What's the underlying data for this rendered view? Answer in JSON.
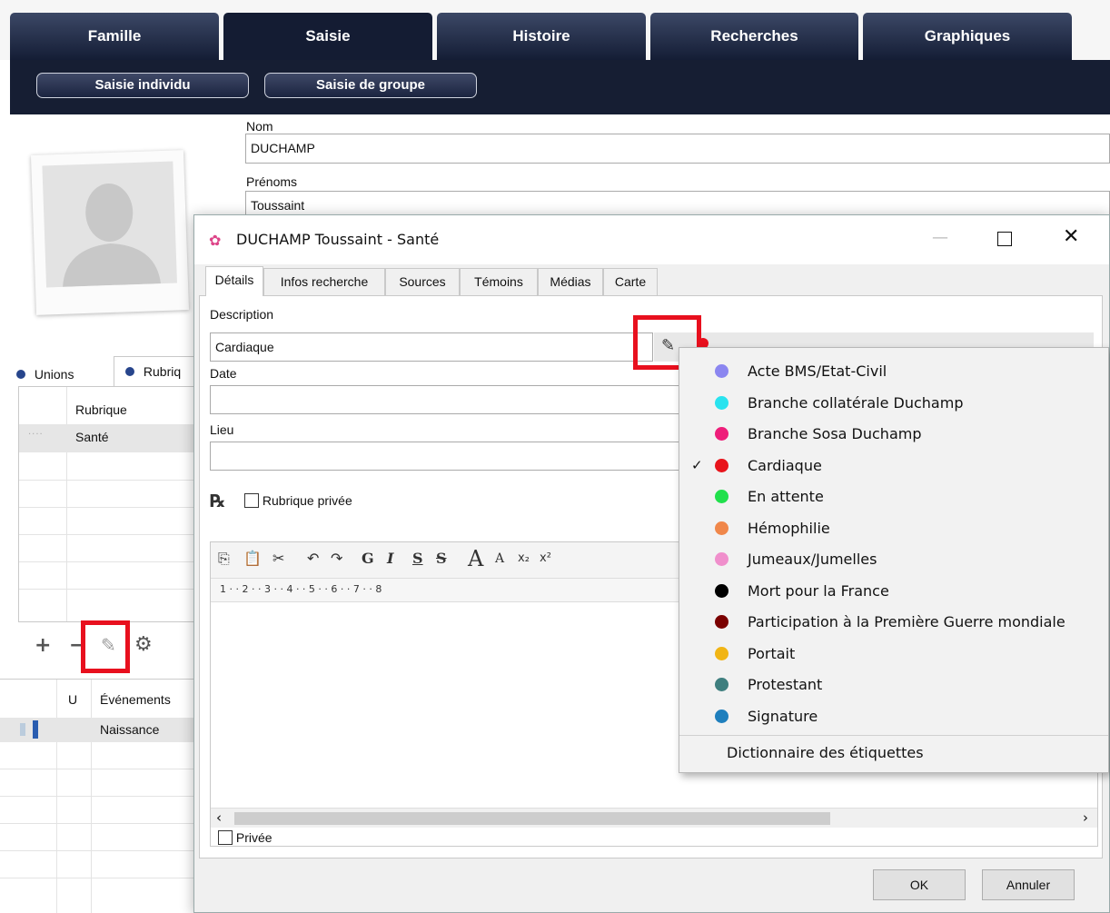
{
  "main_tabs": [
    "Famille",
    "Saisie",
    "Histoire",
    "Recherches",
    "Graphiques"
  ],
  "sub_buttons": [
    "Saisie individu",
    "Saisie de groupe"
  ],
  "person": {
    "nom_label": "Nom",
    "nom_value": "DUCHAMP",
    "prenoms_label": "Prénoms",
    "prenoms_value": "Toussaint"
  },
  "left_tabs": {
    "unions": "Unions",
    "rubriques": "Rubriq"
  },
  "rubriques_table": {
    "header": "Rubrique",
    "row": "Santé"
  },
  "events_table": {
    "col_u": "U",
    "col_events": "Événements",
    "row": "Naissance"
  },
  "dialog": {
    "title": "DUCHAMP Toussaint - Santé",
    "tabs": [
      "Détails",
      "Infos recherche",
      "Sources",
      "Témoins",
      "Médias",
      "Carte"
    ],
    "description_label": "Description",
    "description_value": "Cardiaque",
    "date_label": "Date",
    "lieu_label": "Lieu",
    "private_rubric_label": "Rubrique privée",
    "ruler": "1 · · 2 · · 3 · · 4 · · 5 · · 6 · · 7 · · 8",
    "private_label": "Privée",
    "ok": "OK",
    "cancel": "Annuler",
    "toolbar": {
      "bold": "G",
      "italic": "I",
      "underline": "S",
      "strike": "S",
      "grow": "A",
      "shrink": "A",
      "sub": "x₂",
      "sup": "x²"
    }
  },
  "tag_menu": {
    "items": [
      {
        "label": "Acte BMS/Etat-Civil",
        "color": "#8b86f0",
        "checked": false
      },
      {
        "label": "Branche collatérale Duchamp",
        "color": "#29e3ef",
        "checked": false
      },
      {
        "label": "Branche Sosa Duchamp",
        "color": "#ee1e7a",
        "checked": false
      },
      {
        "label": "Cardiaque",
        "color": "#e8141b",
        "checked": true
      },
      {
        "label": "En attente",
        "color": "#21e04c",
        "checked": false
      },
      {
        "label": "Hémophilie",
        "color": "#f0874a",
        "checked": false
      },
      {
        "label": "Jumeaux/Jumelles",
        "color": "#f08fcc",
        "checked": false
      },
      {
        "label": "Mort pour la France",
        "color": "#000000",
        "checked": false
      },
      {
        "label": "Participation à la Première Guerre mondiale",
        "color": "#7a0000",
        "checked": false
      },
      {
        "label": "Portait",
        "color": "#f1b515",
        "checked": false
      },
      {
        "label": "Protestant",
        "color": "#3f7f7f",
        "checked": false
      },
      {
        "label": "Signature",
        "color": "#1f7fbd",
        "checked": false
      }
    ],
    "footer": "Dictionnaire des étiquettes"
  },
  "highlight_color": "#e8101e"
}
